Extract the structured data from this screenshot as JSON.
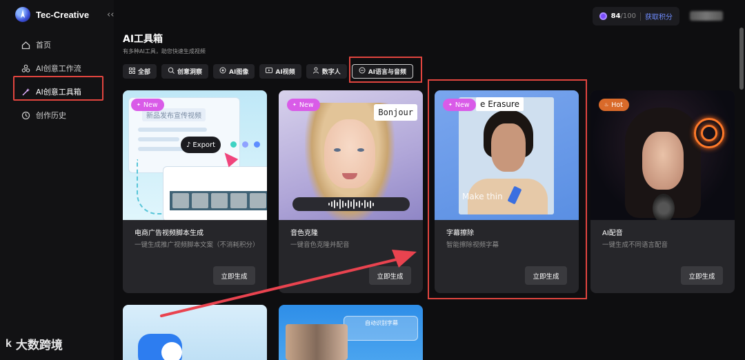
{
  "app": {
    "name": "Tec-Creative",
    "collapse_glyph": "‹‹"
  },
  "sidebar": {
    "items": [
      {
        "label": "首页",
        "icon": "home-icon"
      },
      {
        "label": "AI创意工作流",
        "icon": "workflow-icon"
      },
      {
        "label": "AI创意工具箱",
        "icon": "magic-wand-icon",
        "active": true
      },
      {
        "label": "创作历史",
        "icon": "history-icon"
      }
    ]
  },
  "header": {
    "credits": "84",
    "credits_max": "/100",
    "get_credits_label": "获取积分"
  },
  "page": {
    "title": "AI工具箱",
    "subtitle": "有多种AI工具，助您快速生成视频"
  },
  "tabs": [
    {
      "label": "全部",
      "icon": "grid-icon"
    },
    {
      "label": "创意洞察",
      "icon": "insight-icon"
    },
    {
      "label": "AI图像",
      "icon": "image-icon"
    },
    {
      "label": "AI视频",
      "icon": "video-icon"
    },
    {
      "label": "数字人",
      "icon": "person-icon"
    },
    {
      "label": "AI语言与音频",
      "icon": "audio-icon",
      "active": true
    }
  ],
  "cards": [
    {
      "badge": "New",
      "title": "电商广告视频脚本生成",
      "desc": "一键生成推广视频脚本文案（不消耗积分）",
      "button": "立即生成",
      "thumb_doc_title": "新品发布宣传视频",
      "thumb_export": "Export"
    },
    {
      "badge": "New",
      "title": "音色克隆",
      "desc": "一键音色克隆并配音",
      "button": "立即生成",
      "thumb_bubble": "Bonjour"
    },
    {
      "badge": "New",
      "title": "字幕擦除",
      "desc": "智能擦除视频字幕",
      "button": "立即生成",
      "thumb_caption": "e Erasure",
      "thumb_make": "Make thin"
    },
    {
      "badge": "Hot",
      "title": "AI配音",
      "desc": "一键生成不同语言配音",
      "button": "立即生成"
    }
  ],
  "bottom_cards": [
    {
      "thumb_text": ""
    },
    {
      "thumb_text": "自动识别字幕"
    }
  ],
  "watermark": {
    "icon_text": "k",
    "text": "大数跨境"
  },
  "colors": {
    "highlight": "#e2453f",
    "badge_new": "#d95be8",
    "badge_hot": "#d96a2a",
    "accent_link": "#6f8dff"
  }
}
